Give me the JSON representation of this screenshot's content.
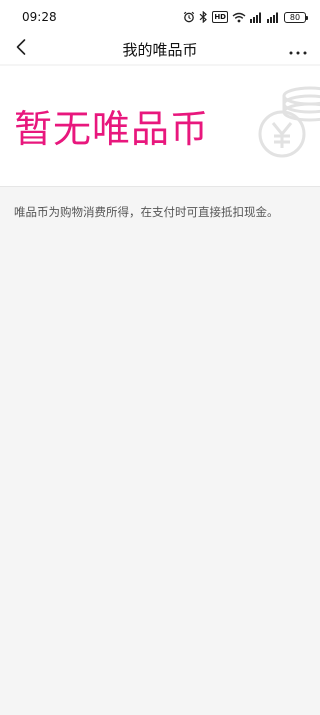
{
  "status_bar": {
    "time": "09:28",
    "icons": [
      "alarm-icon",
      "bluetooth-icon",
      "hd-icon",
      "wifi-icon",
      "signal-icon",
      "signal-icon",
      "battery-icon"
    ],
    "hd_label": "HD",
    "battery_level": "80"
  },
  "nav": {
    "title": "我的唯品币",
    "back_icon": "chevron-left-icon",
    "more_icon": "more-horizontal-icon"
  },
  "hero": {
    "empty_title": "暂无唯品币",
    "illustration_icon": "yen-coin-stack-icon",
    "accent_color": "#e8177d"
  },
  "description": "唯品币为购物消费所得，在支付时可直接抵扣现金。"
}
